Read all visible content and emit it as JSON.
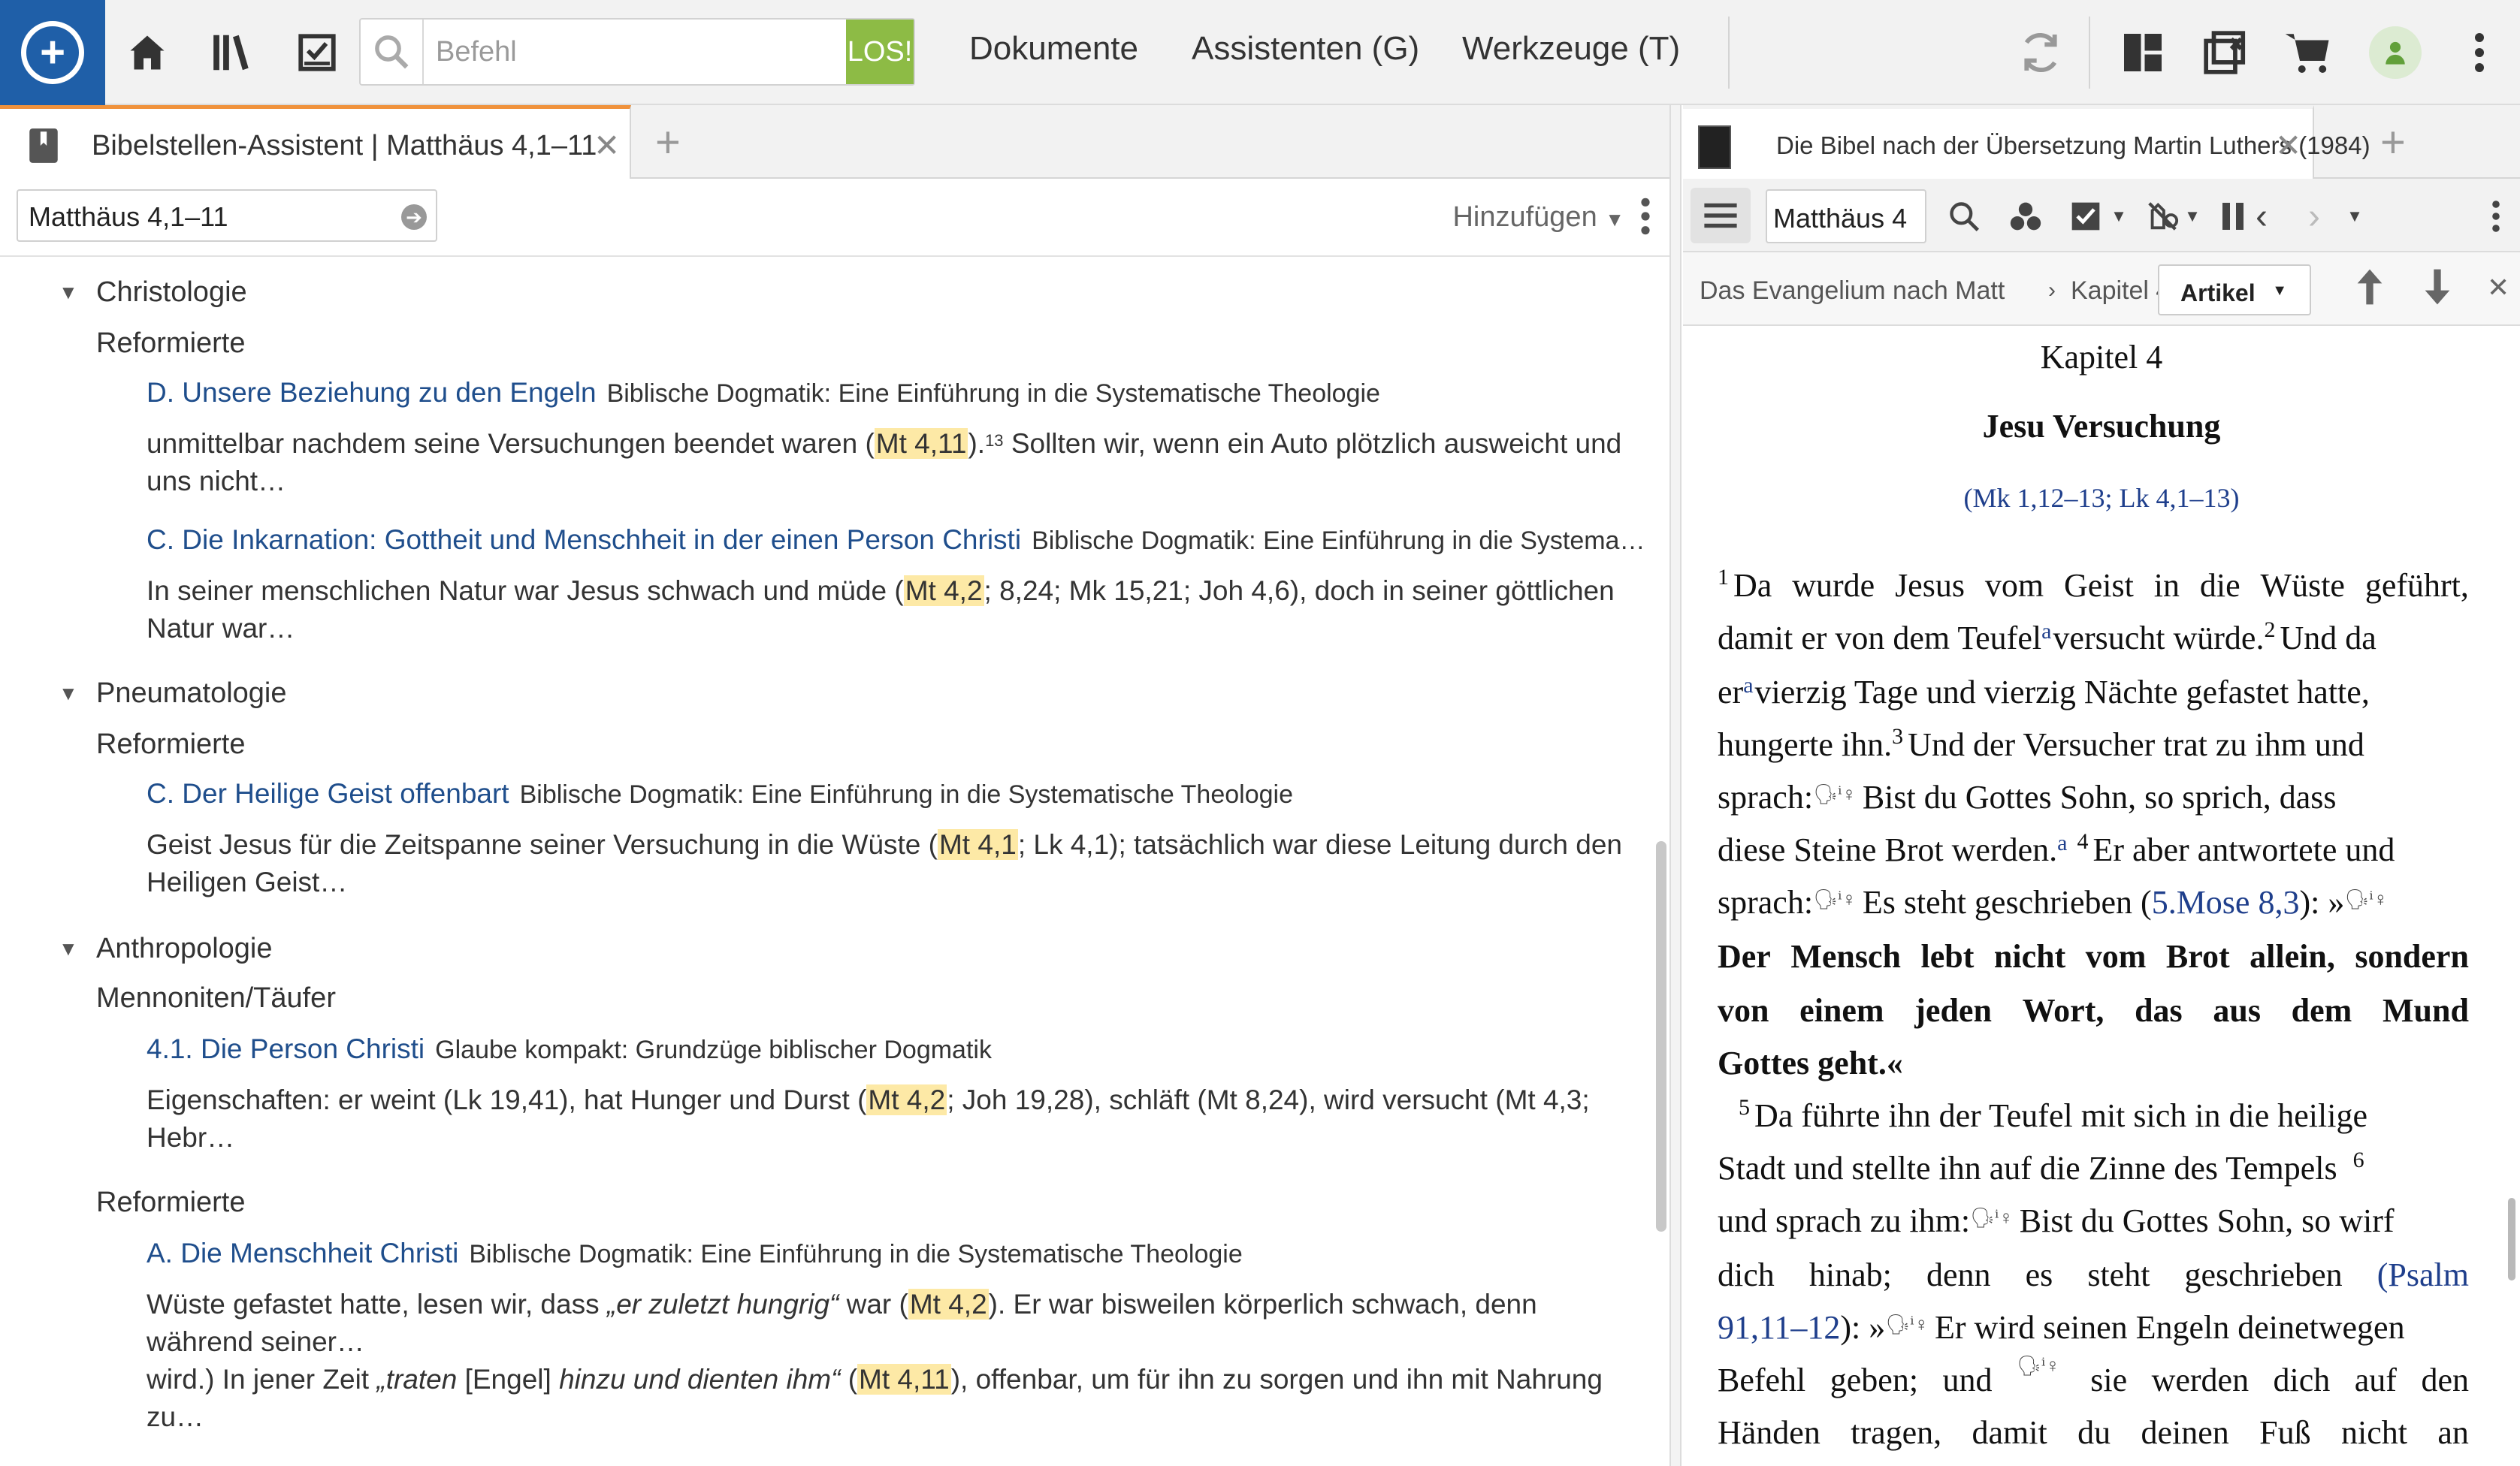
{
  "toolbar": {
    "command_placeholder": "Befehl",
    "go_label": "LOS!",
    "menus": [
      "Dokumente",
      "Assistenten (G)",
      "Werkzeuge (T)"
    ],
    "accent_color": "#1f5fa8",
    "go_color": "#8dbb45",
    "left_icons": [
      "home-icon",
      "library-icon",
      "tasks-icon"
    ],
    "right_icons": [
      "sync-icon",
      "layouts-icon",
      "close-tabs-icon",
      "cart-icon",
      "user-status-icon",
      "more-icon"
    ]
  },
  "left_panel": {
    "tab_title": "Bibelstellen-Assistent | Matthäus 4,1–11",
    "reference": "Matthäus 4,1–11",
    "add_label": "Hinzufügen",
    "sections": [
      {
        "heading": "Christologie",
        "groups": [
          {
            "tradition": "Reformierte",
            "entries": [
              {
                "link": "D. Unsere Beziehung zu den Engeln",
                "source": "Biblische Dogmatik: Eine Einführung in die Systematische Theologie",
                "pre": "unmittelbar nachdem seine Versuchungen beendet waren (",
                "hl": "Mt 4,11",
                "post": ").",
                "sup": "13",
                "post2": " Sollten wir, wenn ein Auto plötzlich ausweicht und uns nicht…"
              },
              {
                "link": "C. Die Inkarnation: Gottheit und Menschheit in der einen Person Christi",
                "source": "Biblische Dogmatik: Eine Einführung in die Systema…",
                "pre": "In seiner menschlichen Natur war Jesus schwach und müde (",
                "hl": "Mt 4,2",
                "post": "; 8,24; Mk 15,21; Joh 4,6), doch in seiner göttlichen Natur war…"
              }
            ]
          }
        ]
      },
      {
        "heading": "Pneumatologie",
        "groups": [
          {
            "tradition": "Reformierte",
            "entries": [
              {
                "link": "C. Der Heilige Geist offenbart",
                "source": "Biblische Dogmatik: Eine Einführung in die Systematische Theologie",
                "pre": "Geist Jesus für die Zeitspanne seiner Versuchung in die Wüste (",
                "hl": "Mt 4,1",
                "post": "; Lk 4,1); tatsächlich war diese Leitung durch den Heiligen Geist…"
              }
            ]
          }
        ]
      },
      {
        "heading": "Anthropologie",
        "groups": [
          {
            "tradition": "Mennoniten/Täufer",
            "entries": [
              {
                "link": "4.1. Die Person Christi",
                "source": "Glaube kompakt: Grundzüge biblischer Dogmatik",
                "pre": "Eigenschaften: er weint (Lk 19,41), hat Hunger und Durst (",
                "hl": "Mt 4,2",
                "post": "; Joh 19,28), schläft (Mt 8,24), wird versucht (Mt 4,3; Hebr…"
              }
            ]
          },
          {
            "tradition": "Reformierte",
            "entries": [
              {
                "link": "A. Die Menschheit Christi",
                "source": "Biblische Dogmatik: Eine Einführung in die Systematische Theologie",
                "pre": "Wüste gefastet hatte, lesen wir, dass ",
                "italic": "„er zuletzt hungrig“",
                "pre2": " war (",
                "hl": "Mt 4,2",
                "post": "). Er war bisweilen körperlich schwach, denn während seiner…",
                "line2_pre": "wird.) In jener Zeit ",
                "line2_it1": "„traten",
                "line2_mid": " [Engel] ",
                "line2_it2": "hinzu und dienten ihm“",
                "line2_pre2": " (",
                "line2_hl": "Mt 4,11",
                "line2_post": "), offenbar, um für ihn zu sorgen und ihn mit Nahrung zu…"
              }
            ]
          }
        ]
      }
    ]
  },
  "right_panel": {
    "tab_title": "Die Bibel nach der Übersetzung Martin Luthers (1984)",
    "reference": "Matthäus 4",
    "breadcrumb_book": "Das Evangelium nach Matt",
    "breadcrumb_chapter": "Kapitel 4",
    "article_select": "Artikel",
    "chapter_title": "Kapitel 4",
    "pericope_title": "Jesu Versuchung",
    "parallels_open": "(",
    "parallels_mk": "Mk 1,12–13",
    "parallels_sep": "; ",
    "parallels_lk": "Lk 4,1–13",
    "parallels_close": ")",
    "verses": {
      "v1_num": "1",
      "l1": [
        "Da",
        "wurde",
        "Jesus",
        "vom",
        "Geist",
        "in",
        "die",
        "Wüste",
        "geführt,"
      ],
      "l2a": "damit er von dem Teufel ",
      "fn_a": "a",
      "l2b": "versucht würde. ",
      "v2_num": "2",
      "l2c": "Und da",
      "l3a": "er ",
      "l3b": "vierzig Tage und vierzig Nächte gefastet hatte,",
      "l4a": "hungerte ihn. ",
      "v3_num": "3",
      "l4b": "Und der Versucher trat zu ihm und",
      "l5a": "sprach: ",
      "speaker": "🗣",
      "l5b": "Bist du Gottes Sohn, so sprich, dass",
      "l6a": "diese Steine Brot werden.",
      "v4_num": "4",
      "l6b": "Er aber antwortete und",
      "l7a": "sprach: ",
      "l7b": "Es steht geschrieben (",
      "ref_mose": "5.Mose 8,3",
      "l7c": "): »",
      "l8": [
        "Der",
        "Mensch",
        "lebt",
        "nicht",
        "vom",
        "Brot",
        "allein,",
        "sondern"
      ],
      "l9": [
        "von",
        "einem",
        "jeden",
        "Wort,",
        "das",
        "aus",
        "dem",
        "Mund"
      ],
      "l10": "Gottes geht.«",
      "v5_num": "5",
      "l11": "Da führte ihn der Teufel mit sich in die heilige",
      "l12a": "Stadt und stellte ihn auf die Zinne des Tempels",
      "v6_num": "6",
      "l13a": "und sprach zu ihm: ",
      "l13b": "Bist du Gottes Sohn, so wirf",
      "l14a": [
        "dich",
        "hinab;",
        "denn",
        "es",
        "steht",
        "geschrieben"
      ],
      "ref_psalm_a": "(Psalm",
      "ref_psalm_b": "91,11–12",
      "l15a": "): »",
      "l15b": "Er wird seinen Engeln deinetwegen",
      "l16a": [
        "Befehl",
        "geben;",
        "und"
      ],
      "l16b": [
        "sie",
        "werden",
        "dich",
        "auf",
        "den"
      ],
      "l17": [
        "Händen",
        "tragen,",
        "damit",
        "du",
        "deinen",
        "Fuß",
        "nicht",
        "an"
      ]
    }
  }
}
